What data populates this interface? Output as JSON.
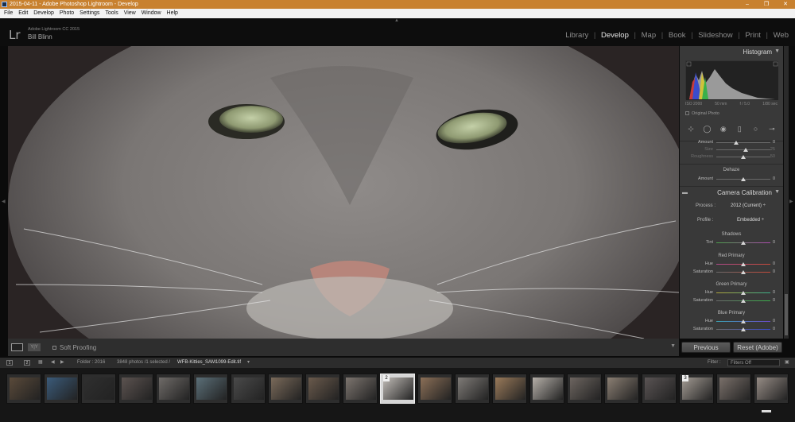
{
  "window": {
    "title": "2015-04-11 - Adobe Photoshop Lightroom - Develop",
    "minimize": "–",
    "maximize": "❐",
    "close": "✕"
  },
  "menu": [
    "File",
    "Edit",
    "Develop",
    "Photo",
    "Settings",
    "Tools",
    "View",
    "Window",
    "Help"
  ],
  "identity": {
    "logo": "Lr",
    "app_name": "Adobe Lightroom CC 2015",
    "user": "Bill Blinn"
  },
  "modules": [
    "Library",
    "Develop",
    "Map",
    "Book",
    "Slideshow",
    "Print",
    "Web"
  ],
  "active_module": "Develop",
  "toolbar": {
    "view_toggle": "Y|Y",
    "soft_proofing": "Soft Proofing"
  },
  "right_panel": {
    "histogram_title": "Histogram",
    "histogram_info": [
      "ISO 2000",
      "50 mm",
      "f / 5.0",
      "1/80 sec"
    ],
    "original_photo": "Original Photo",
    "detail_rows": [
      {
        "label": "Amount",
        "value": "0",
        "level": 0.0,
        "dim": false
      },
      {
        "label": "Size",
        "value": "25",
        "level": 0.25,
        "dim": true
      },
      {
        "label": "Roughness",
        "value": "50",
        "level": 0.5,
        "dim": true
      }
    ],
    "dehaze_title": "Dehaze",
    "dehaze_amount": {
      "label": "Amount",
      "value": "0"
    },
    "camera_calibration_title": "Camera Calibration",
    "process_label": "Process :",
    "process_value": "2012 (Current) ÷",
    "profile_label": "Profile :",
    "profile_value": "Embedded ÷",
    "shadows_title": "Shadows",
    "shadows_tint": {
      "label": "Tint",
      "value": "0"
    },
    "red_primary_title": "Red Primary",
    "red_hue": {
      "label": "Hue",
      "value": "0"
    },
    "red_saturation": {
      "label": "Saturation",
      "value": "0"
    },
    "green_primary_title": "Green Primary",
    "green_hue": {
      "label": "Hue",
      "value": "0"
    },
    "green_saturation": {
      "label": "Saturation",
      "value": "0"
    },
    "blue_primary_title": "Blue Primary",
    "blue_hue": {
      "label": "Hue",
      "value": "0"
    },
    "blue_saturation": {
      "label": "Saturation",
      "value": "0"
    }
  },
  "buttons": {
    "previous": "Previous",
    "reset": "Reset (Adobe)"
  },
  "filmstrip_bar": {
    "screen1": "1",
    "screen2": "2",
    "folder": "Folder : 2016",
    "photo_count": "3848 photos /1 selected /",
    "filename": "WFB-Kitties_SAM1099-Edit.tif",
    "filename_arrow": "▾",
    "filter_label": "Filter :",
    "filter_value": "Filters Off"
  },
  "filmstrip": {
    "selected_badge": "2",
    "second_badge": "3",
    "thumbs": [
      "#5a4a3a",
      "#3b5b7a",
      "#2f2f2f",
      "#5c5350",
      "#6f6b68",
      "#5b6f78",
      "#4a4a4a",
      "#7a6a5a",
      "#6a5a4c",
      "#7d756f",
      "#c2bdb8",
      "#8b6f57",
      "#7f7b77",
      "#9a7a5a",
      "#b6b0a9",
      "#6d6560",
      "#8b7f73",
      "#5a5454",
      "#a49c94",
      "#7a706a",
      "#968c85"
    ]
  },
  "colors": {
    "title_bar": "#c8812f",
    "panel_bg": "#393939",
    "selected_thumb": "#d6d6d6"
  }
}
